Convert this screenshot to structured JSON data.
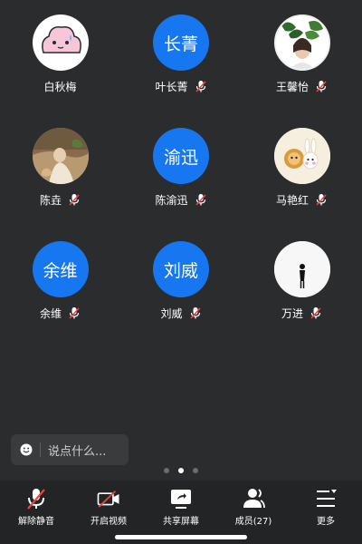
{
  "participants": [
    {
      "name": "白秋梅",
      "avatar_text": "",
      "avatar_kind": "image",
      "avatar_icon": "pink-cloud-avatar-icon",
      "muted": false
    },
    {
      "name": "叶长菁",
      "avatar_text": "长菁",
      "avatar_kind": "initials",
      "muted": true
    },
    {
      "name": "王馨怡",
      "avatar_text": "",
      "avatar_kind": "image",
      "avatar_icon": "plant-portrait-avatar-icon",
      "muted": true
    },
    {
      "name": "陈垚",
      "avatar_text": "",
      "avatar_kind": "image",
      "avatar_icon": "painting-avatar-icon",
      "muted": true
    },
    {
      "name": "陈渝迅",
      "avatar_text": "渝迅",
      "avatar_kind": "initials",
      "muted": true
    },
    {
      "name": "马艳红",
      "avatar_text": "",
      "avatar_kind": "image",
      "avatar_icon": "cartoon-animals-avatar-icon",
      "muted": true
    },
    {
      "name": "余维",
      "avatar_text": "余维",
      "avatar_kind": "initials",
      "muted": true
    },
    {
      "name": "刘威",
      "avatar_text": "刘威",
      "avatar_kind": "initials",
      "muted": true
    },
    {
      "name": "万进",
      "avatar_text": "",
      "avatar_kind": "image",
      "avatar_icon": "silhouette-avatar-icon",
      "muted": true
    }
  ],
  "chat": {
    "placeholder": "说点什么..."
  },
  "pager": {
    "pages": 3,
    "current": 2
  },
  "toolbar": {
    "unmute": "解除静音",
    "start_video": "开启视频",
    "share_screen": "共享屏幕",
    "members": "成员(27)",
    "more": "更多"
  },
  "colors": {
    "background": "#2b2c2e",
    "toolbar_bg": "#232426",
    "avatar_blue": "#1677f0",
    "mute_red": "#e8473f"
  }
}
